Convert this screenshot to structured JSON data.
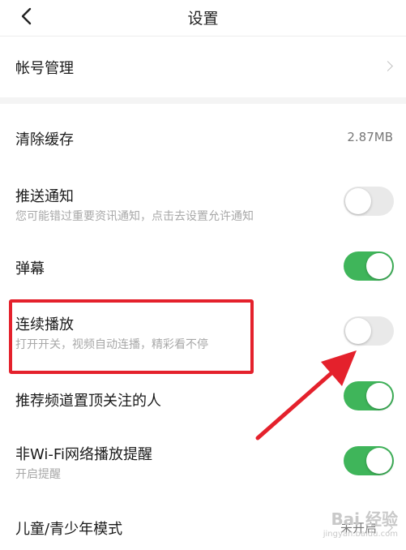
{
  "header": {
    "title": "设置",
    "back_icon": "chevron-left-icon"
  },
  "settings": {
    "account": {
      "label": "帐号管理"
    },
    "clear_cache": {
      "label": "清除缓存",
      "value": "2.87MB"
    },
    "push": {
      "label": "推送通知",
      "sub": "您可能错过重要资讯通知，点击去设置允许通知",
      "enabled": false
    },
    "danmaku": {
      "label": "弹幕",
      "enabled": true
    },
    "autoplay": {
      "label": "连续播放",
      "sub": "打开开关，视频自动连播，精彩看不停",
      "enabled": false
    },
    "pin_followed": {
      "label": "推荐频道置顶关注的人",
      "enabled": true
    },
    "non_wifi": {
      "label": "非Wi-Fi网络播放提醒",
      "sub": "开启提醒",
      "enabled": true
    },
    "kids_mode": {
      "label": "儿童/青少年模式",
      "value": "未开启"
    }
  },
  "annotation": {
    "highlight_color": "#e4212c",
    "arrow_color": "#e4212c"
  },
  "colors": {
    "toggle_on": "#3fb55a",
    "toggle_off": "#e9e9e9"
  },
  "watermark": {
    "text": "Bai 经验",
    "url": "jingyan.baidu.com"
  }
}
